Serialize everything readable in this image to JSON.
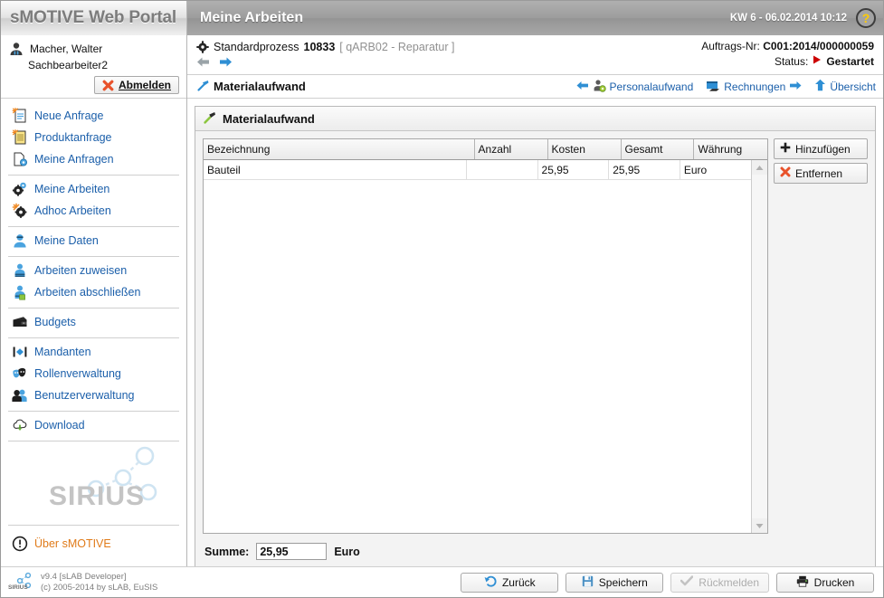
{
  "header": {
    "brand": "sMOTIVE Web Portal",
    "page_title": "Meine Arbeiten",
    "clock": "KW 6 - 06.02.2014 10:12",
    "help_icon": "question-mark-icon"
  },
  "user": {
    "name": "Macher, Walter",
    "role": "Sachbearbeiter2",
    "logout_label": "Abmelden"
  },
  "sidebar": {
    "groups": [
      {
        "items": [
          {
            "label": "Neue Anfrage",
            "icon": "new-request-document-icon"
          },
          {
            "label": "Produktanfrage",
            "icon": "product-request-document-icon"
          },
          {
            "label": "Meine Anfragen",
            "icon": "my-requests-document-icon"
          }
        ]
      },
      {
        "items": [
          {
            "label": "Meine Arbeiten",
            "icon": "gears-icon"
          },
          {
            "label": "Adhoc Arbeiten",
            "icon": "adhoc-gears-icon"
          }
        ]
      },
      {
        "items": [
          {
            "label": "Meine Daten",
            "icon": "user-data-icon"
          }
        ]
      },
      {
        "items": [
          {
            "label": "Arbeiten zuweisen",
            "icon": "assign-work-icon"
          },
          {
            "label": "Arbeiten abschließen",
            "icon": "complete-work-icon"
          }
        ]
      },
      {
        "items": [
          {
            "label": "Budgets",
            "icon": "wallet-icon"
          }
        ]
      },
      {
        "items": [
          {
            "label": "Mandanten",
            "icon": "clients-icon"
          },
          {
            "label": "Rollenverwaltung",
            "icon": "roles-masks-icon"
          },
          {
            "label": "Benutzerverwaltung",
            "icon": "users-icon"
          }
        ]
      },
      {
        "items": [
          {
            "label": "Download",
            "icon": "cloud-download-icon"
          }
        ]
      }
    ],
    "watermark": "SIRIUS",
    "about": {
      "label": "Über sMOTIVE",
      "icon": "info-circle-icon"
    }
  },
  "footer_version": {
    "line1": "v9.4 [sLAB Developer]",
    "line2": "(c) 2005-2014 by sLAB, EuSIS",
    "logo": "sirius-logo-icon"
  },
  "process": {
    "icon": "gear-icon",
    "type_label": "Standardprozess",
    "number": "10833",
    "code": "[ qARB02 - Reparatur ]",
    "back_arrow_icon": "arrow-left-icon",
    "forward_arrow_icon": "arrow-right-icon",
    "order_label": "Auftrags-Nr:",
    "order_value": "C001:2014/000000059",
    "status_label": "Status:",
    "status_value": "Gestartet",
    "status_icon": "play-triangle-icon",
    "status_color": "#cc0000"
  },
  "crumb": {
    "icon": "hammer-icon",
    "label": "Materialaufwand",
    "links": [
      {
        "label": "Personalaufwand",
        "icon": "personnel-icon",
        "arrow": "left"
      },
      {
        "label": "Rechnungen",
        "icon": "invoice-icon",
        "arrow": "right"
      },
      {
        "label": "Übersicht",
        "icon": "arrow-up-icon",
        "arrow": "none"
      }
    ]
  },
  "panel": {
    "icon": "hammer-green-icon",
    "title": "Materialaufwand",
    "columns": [
      "Bezeichnung",
      "Anzahl",
      "Kosten",
      "Gesamt",
      "Währung"
    ],
    "rows": [
      {
        "Bezeichnung": "Bauteil",
        "Anzahl": "",
        "Kosten": "25,95",
        "Gesamt": "25,95",
        "Währung": "Euro"
      }
    ],
    "buttons": [
      {
        "label": "Hinzufügen",
        "icon": "plus-icon"
      },
      {
        "label": "Entfernen",
        "icon": "remove-x-icon"
      }
    ],
    "sum_label": "Summe:",
    "sum_value": "25,95",
    "sum_currency": "Euro",
    "scroll_up_icon": "scroll-up-arrow-icon",
    "scroll_down_icon": "scroll-down-arrow-icon"
  },
  "actions": [
    {
      "label": "Zurück",
      "icon": "undo-arrow-icon",
      "disabled": false
    },
    {
      "label": "Speichern",
      "icon": "floppy-disk-icon",
      "disabled": false
    },
    {
      "label": "Rückmelden",
      "icon": "check-icon",
      "disabled": true
    },
    {
      "label": "Drucken",
      "icon": "printer-icon",
      "disabled": false
    }
  ],
  "colors": {
    "link": "#1b5faa",
    "accent_orange": "#e07b1a",
    "status_red": "#cc0000",
    "header_grey": "#9d9d9d"
  }
}
